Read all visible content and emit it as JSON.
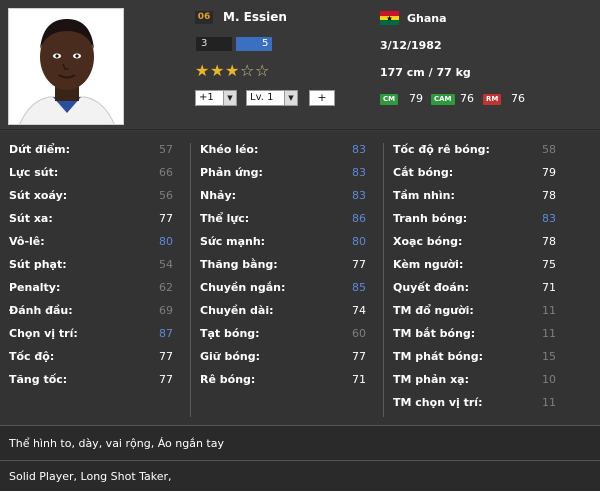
{
  "player": {
    "ovr_badge": "06",
    "name": "M. Essien",
    "level_left": "3",
    "level_right": "5",
    "stars_filled": 3,
    "stars_total": 5,
    "upgrade_select": "+1",
    "level_select": "Lv. 1",
    "plus_button": "+",
    "country": "Ghana",
    "birth_date": "3/12/1982",
    "height_weight": "177 cm / 77 kg"
  },
  "positions": [
    {
      "code": "CM",
      "value": "79",
      "color": "#2e9a3c"
    },
    {
      "code": "CAM",
      "value": "76",
      "color": "#2e9a3c"
    },
    {
      "code": "RM",
      "value": "76",
      "color": "#c33131"
    }
  ],
  "colors": {
    "stat_gray": "#7e7e7e",
    "stat_white": "#ffffff",
    "stat_blue": "#5b8ad8"
  },
  "stats": {
    "col1": [
      {
        "label": "Dứt điểm:",
        "value": "57",
        "tone": "gray"
      },
      {
        "label": "Lực sút:",
        "value": "66",
        "tone": "gray"
      },
      {
        "label": "Sút xoáy:",
        "value": "56",
        "tone": "gray"
      },
      {
        "label": "Sút xa:",
        "value": "77",
        "tone": "white"
      },
      {
        "label": "Vô-lê:",
        "value": "80",
        "tone": "blue"
      },
      {
        "label": "Sút phạt:",
        "value": "54",
        "tone": "gray"
      },
      {
        "label": "Penalty:",
        "value": "62",
        "tone": "gray"
      },
      {
        "label": "Đánh đầu:",
        "value": "69",
        "tone": "gray"
      },
      {
        "label": "Chọn vị trí:",
        "value": "87",
        "tone": "blue"
      },
      {
        "label": "Tốc độ:",
        "value": "77",
        "tone": "white"
      },
      {
        "label": "Tăng tốc:",
        "value": "77",
        "tone": "white"
      }
    ],
    "col2": [
      {
        "label": "Khéo léo:",
        "value": "83",
        "tone": "blue"
      },
      {
        "label": "Phản ứng:",
        "value": "83",
        "tone": "blue"
      },
      {
        "label": "Nhảy:",
        "value": "83",
        "tone": "blue"
      },
      {
        "label": "Thể lực:",
        "value": "86",
        "tone": "blue"
      },
      {
        "label": "Sức mạnh:",
        "value": "80",
        "tone": "blue"
      },
      {
        "label": "Thăng bằng:",
        "value": "77",
        "tone": "white"
      },
      {
        "label": "Chuyền ngắn:",
        "value": "85",
        "tone": "blue"
      },
      {
        "label": "Chuyền dài:",
        "value": "74",
        "tone": "white"
      },
      {
        "label": "Tạt bóng:",
        "value": "60",
        "tone": "gray"
      },
      {
        "label": "Giữ bóng:",
        "value": "77",
        "tone": "white"
      },
      {
        "label": "Rê bóng:",
        "value": "71",
        "tone": "white"
      }
    ],
    "col3": [
      {
        "label": "Tốc độ rê bóng:",
        "value": "58",
        "tone": "gray"
      },
      {
        "label": "Cắt bóng:",
        "value": "79",
        "tone": "white"
      },
      {
        "label": "Tầm nhìn:",
        "value": "78",
        "tone": "white"
      },
      {
        "label": "Tranh bóng:",
        "value": "83",
        "tone": "blue"
      },
      {
        "label": "Xoạc bóng:",
        "value": "78",
        "tone": "white"
      },
      {
        "label": "Kèm người:",
        "value": "75",
        "tone": "white"
      },
      {
        "label": "Quyết đoán:",
        "value": "71",
        "tone": "white"
      },
      {
        "label": "TM đổ người:",
        "value": "11",
        "tone": "gray"
      },
      {
        "label": "TM bắt bóng:",
        "value": "11",
        "tone": "gray"
      },
      {
        "label": "TM phát bóng:",
        "value": "15",
        "tone": "gray"
      },
      {
        "label": "TM phản xạ:",
        "value": "10",
        "tone": "gray"
      },
      {
        "label": "TM chọn vị trí:",
        "value": "11",
        "tone": "gray"
      }
    ]
  },
  "body_type": "Thể hình to, dày, vai rộng, Áo ngắn tay",
  "traits": "Solid Player, Long Shot Taker,"
}
